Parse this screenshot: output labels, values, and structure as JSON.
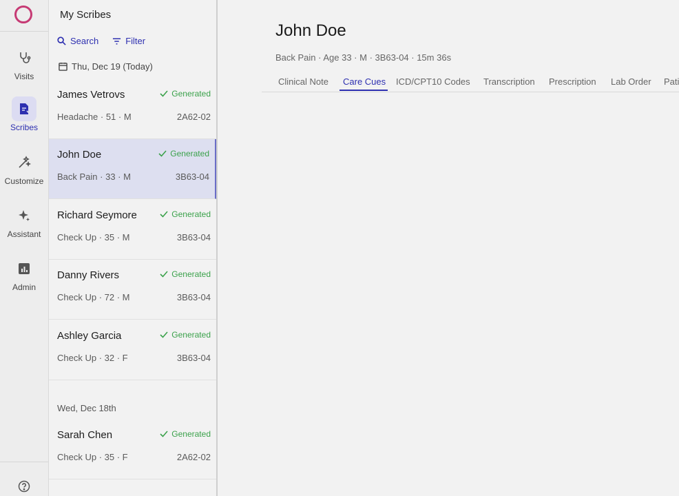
{
  "rail": {
    "items": [
      {
        "label": "Visits",
        "icon": "stethoscope-icon"
      },
      {
        "label": "Scribes",
        "icon": "scribe-document-icon"
      },
      {
        "label": "Customize",
        "icon": "magic-wand-icon"
      },
      {
        "label": "Assistant",
        "icon": "sparkle-icon"
      },
      {
        "label": "Admin",
        "icon": "chart-icon"
      }
    ],
    "active": "Scribes"
  },
  "list": {
    "title": "My Scribes",
    "search_label": "Search",
    "filter_label": "Filter",
    "today_label": "Thu, Dec 19 (Today)",
    "yesterday_label": "Wed, Dec 18th",
    "rows": [
      {
        "name": "James Vetrovs",
        "status": "Generated",
        "meta": "Headache · 51 · M",
        "code": "2A62-02"
      },
      {
        "name": "John Doe",
        "status": "Generated",
        "meta": "Back Pain · 33 · M",
        "code": "3B63-04"
      },
      {
        "name": "Richard Seymore",
        "status": "Generated",
        "meta": "Check Up · 35 · M",
        "code": "3B63-04"
      },
      {
        "name": "Danny Rivers",
        "status": "Generated",
        "meta": "Check Up · 72 · M",
        "code": "3B63-04"
      },
      {
        "name": "Ashley Garcia",
        "status": "Generated",
        "meta": "Check Up · 32 · F",
        "code": "3B63-04"
      },
      {
        "name": "Sarah Chen",
        "status": "Generated",
        "meta": "Check Up · 35 · F",
        "code": "2A62-02"
      }
    ]
  },
  "main": {
    "patient_name": "John Doe",
    "patient_meta": "Back Pain · Age 33 · M · 3B63-04 · 15m 36s",
    "tabs": [
      {
        "label": "Clinical Note"
      },
      {
        "label": "Care Cues"
      },
      {
        "label": "ICD/CPT10 Codes"
      },
      {
        "label": "Transcription"
      },
      {
        "label": "Prescription"
      },
      {
        "label": "Lab Order"
      },
      {
        "label": "Pati"
      }
    ],
    "active_tab": "Care Cues"
  },
  "colors": {
    "accent": "#2d2fb0",
    "brand": "#c63a74",
    "status_generated": "#3aa14a",
    "selected_row": "#dddff0"
  }
}
